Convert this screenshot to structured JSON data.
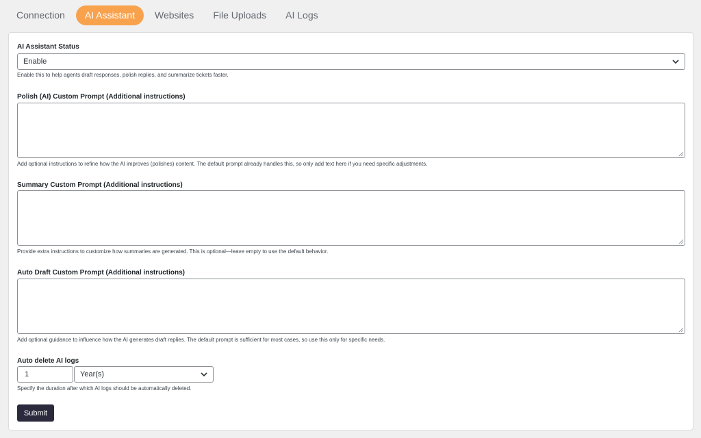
{
  "tabs": [
    {
      "label": "Connection",
      "active": false
    },
    {
      "label": "AI Assistant",
      "active": true
    },
    {
      "label": "Websites",
      "active": false
    },
    {
      "label": "File Uploads",
      "active": false
    },
    {
      "label": "AI Logs",
      "active": false
    }
  ],
  "accent_color": "#f8a24d",
  "status": {
    "label": "AI Assistant Status",
    "value": "Enable",
    "help": "Enable this to help agents draft responses, polish replies, and summarize tickets faster."
  },
  "polish": {
    "label": "Polish (AI) Custom Prompt (Additional instructions)",
    "value": "",
    "help": "Add optional instructions to refine how the AI improves (polishes) content. The default prompt already handles this, so only add text here if you need specific adjustments."
  },
  "summary": {
    "label": "Summary Custom Prompt (Additional instructions)",
    "value": "",
    "help": "Provide extra instructions to customize how summaries are generated. This is optional—leave empty to use the default behavior."
  },
  "auto_draft": {
    "label": "Auto Draft Custom Prompt (Additional instructions)",
    "value": "",
    "help": "Add optional guidance to influence how the AI generates draft replies. The default prompt is sufficient for most cases, so use this only for specific needs."
  },
  "auto_delete": {
    "label": "Auto delete AI logs",
    "number": "1",
    "unit": "Year(s)",
    "help": "Specify the duration after which AI logs should be automatically deleted."
  },
  "submit_label": "Submit",
  "icons": {
    "dropdown": "chevron-down-icon",
    "resize": "resize-handle-icon"
  }
}
